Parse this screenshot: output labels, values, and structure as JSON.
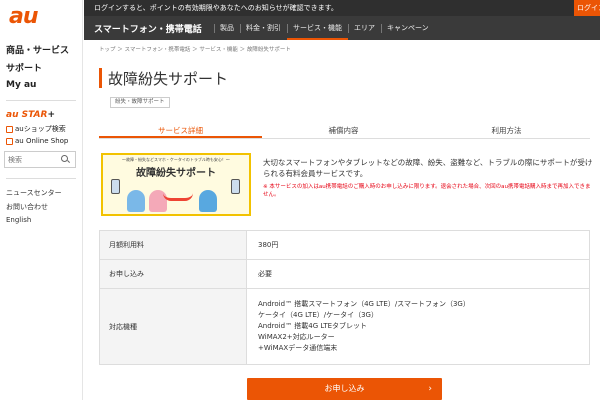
{
  "sidebar": {
    "logo": "au",
    "main_links": [
      "商品・サービス",
      "サポート",
      "My au"
    ],
    "austar": {
      "brand": "au STAR",
      "plus": "+"
    },
    "links": [
      {
        "label": "auショップ検索",
        "icon": "shop-icon"
      },
      {
        "label": "au Online Shop",
        "icon": "cart-icon"
      }
    ],
    "search_placeholder": "検索",
    "footer_links": [
      "ニュースセンター",
      "お問い合わせ",
      "English"
    ]
  },
  "topbar": {
    "notice": "ログインすると、ポイントの有効期限やあなたへのお知らせが確認できます。",
    "login": "ログイン"
  },
  "nav": {
    "brand": "スマートフォン・携帯電話",
    "items": [
      "製品",
      "料金・割引",
      "サービス・機能",
      "エリア",
      "キャンペーン"
    ],
    "active_index": 2
  },
  "breadcrumb": "トップ ＞ スマートフォン・携帯電話 ＞ サービス・機能 ＞ 故障紛失サポート",
  "page": {
    "title": "故障紛失サポート",
    "tag": "紛失・故障サポート"
  },
  "tabs": [
    "サービス詳細",
    "補償内容",
    "利用方法"
  ],
  "banner": {
    "sub": "～故障・紛失などスマホ・ケータイのトラブル時も安心！～",
    "title": "故障紛失サポート"
  },
  "description": "大切なスマートフォンやタブレットなどの故障、紛失、盗難など、トラブルの際にサポートが受けられる有料会員サービスです。",
  "note": "※ 本サービスの加入はau携帯電話のご購入時のお申し込みに限ります。退会された場合、次回のau携帯電話購入時まで再加入できません。",
  "table": {
    "rows": [
      {
        "label": "月額利用料",
        "value": "380円"
      },
      {
        "label": "お申し込み",
        "value": "必要"
      }
    ],
    "devices_label": "対応機種",
    "devices": [
      "Android™ 搭載スマートフォン（4G LTE）/スマートフォン（3G）",
      "ケータイ（4G LTE）/ケータイ（3G）",
      "Android™ 搭載4G LTEタブレット",
      "WiMAX2+対応ルーター",
      "+WiMAXデータ通信端末"
    ]
  },
  "apply_button": "お申し込み",
  "colors": {
    "accent": "#eb5505",
    "dark_bar": "#2f2f2f",
    "warning": "#e60012"
  }
}
